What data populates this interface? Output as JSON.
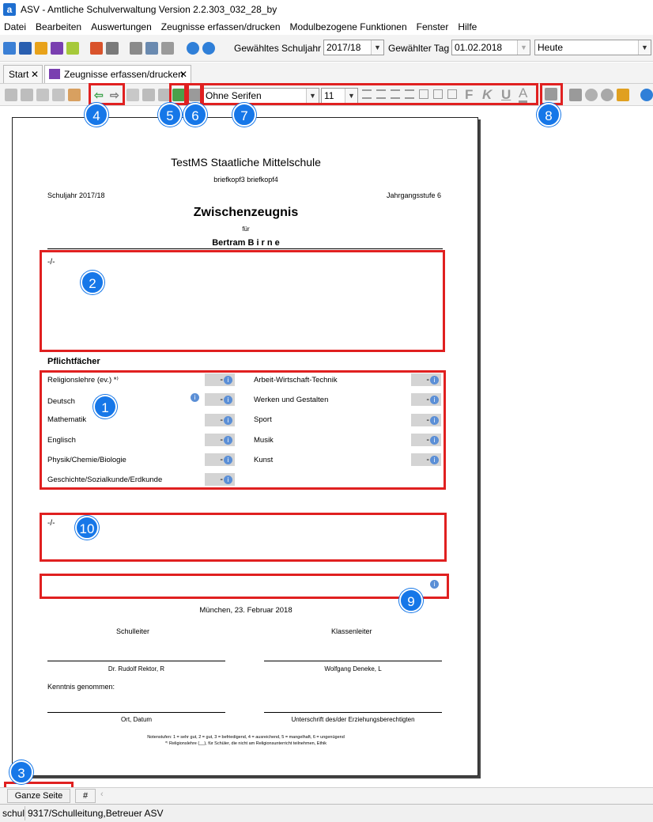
{
  "window": {
    "title": "ASV - Amtliche Schulverwaltung Version 2.2.303_032_28_by",
    "app_icon": "a"
  },
  "menu": [
    "Datei",
    "Bearbeiten",
    "Auswertungen",
    "Zeugnisse erfassen/drucken",
    "Modulbezogene Funktionen",
    "Fenster",
    "Hilfe"
  ],
  "toolbar": {
    "schuljahr_label": "Gewähltes Schuljahr",
    "schuljahr_value": "2017/18",
    "tag_label": "Gewählter Tag",
    "tag_value": "01.02.2018",
    "period_value": "Heute"
  },
  "tabs": [
    {
      "label": "Start",
      "close": "✕"
    },
    {
      "label": "Zeugnisse erfassen/drucken",
      "close": "✕"
    }
  ],
  "editor_toolbar": {
    "font_family": "Ohne Serifen",
    "font_size": "11",
    "format_labels": {
      "bold": "F",
      "italic": "K",
      "underline": "U",
      "color": "A"
    }
  },
  "document": {
    "school_name": "TestMS Staatliche Mittelschule",
    "letterhead": "briefkopf3 briefkopf4",
    "schuljahr": "Schuljahr 2017/18",
    "jahrgangsstufe": "Jahrgangsstufe 6",
    "doc_title": "Zwischenzeugnis",
    "fuer": "für",
    "student_name": "Bertram  B i r n e",
    "remarks_text": "-/-",
    "pflichtfaecher_heading": "Pflichtfächer",
    "subjects_left": [
      {
        "name": "Religionslehre (ev.) *⁾",
        "grade": "-"
      },
      {
        "name": "Deutsch",
        "grade": "-"
      },
      {
        "name": "Mathematik",
        "grade": "-"
      },
      {
        "name": "Englisch",
        "grade": "-"
      },
      {
        "name": "Physik/Chemie/Biologie",
        "grade": "-"
      },
      {
        "name": "Geschichte/Sozialkunde/Erdkunde",
        "grade": "-"
      }
    ],
    "subjects_right": [
      {
        "name": "Arbeit-Wirtschaft-Technik",
        "grade": "-"
      },
      {
        "name": "Werken und Gestalten",
        "grade": "-"
      },
      {
        "name": "Sport",
        "grade": "-"
      },
      {
        "name": "Musik",
        "grade": "-"
      },
      {
        "name": "Kunst",
        "grade": "-"
      }
    ],
    "section10_text": "-/-",
    "place_date": "München, 23. Februar 2018",
    "schulleiter_label": "Schulleiter",
    "klassenleiter_label": "Klassenleiter",
    "schulleiter_name": "Dr. Rudolf Rektor, R",
    "klassenleiter_name": "Wolfgang Deneke, L",
    "kenntnis_label": "Kenntnis genommen:",
    "ort_datum": "Ort, Datum",
    "unterschrift": "Unterschrift des/der Erziehungsberechtigten",
    "footnote1": "Notenstufen: 1 = sehr gut, 2 = gut, 3 = befriedigend, 4 = ausreichend, 5 = mangelhaft, 6 = ungenügend",
    "footnote2": "*⁾ Religionslehre (__), für Schüler, die nicht am Religionsunterricht teilnehmen, Ethik"
  },
  "callouts": [
    "1",
    "2",
    "3",
    "4",
    "5",
    "6",
    "7",
    "8",
    "9",
    "10"
  ],
  "bottom": {
    "zoom_button": "Ganze Seite",
    "grid_button": "#"
  },
  "status": {
    "left": "schul",
    "right": "9317/Schulleitung,Betreuer ASV"
  },
  "colors": {
    "highlight": "#e02020",
    "badge": "#1677e8"
  }
}
